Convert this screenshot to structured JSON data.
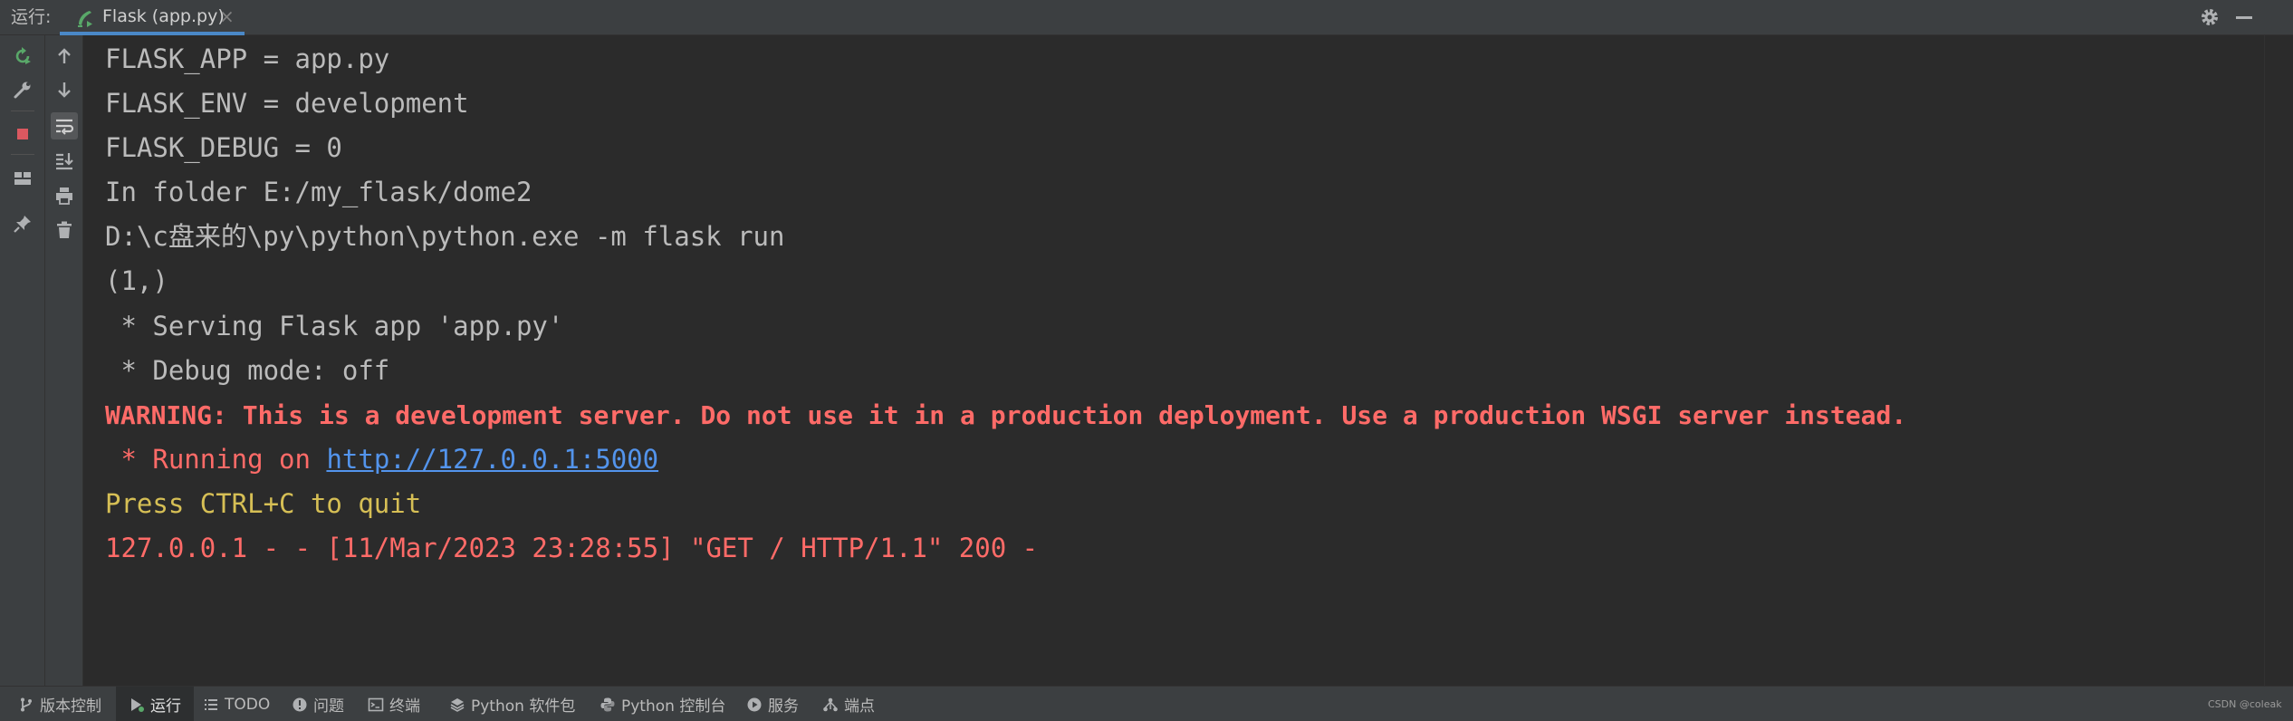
{
  "header": {
    "run_label": "运行:",
    "tab_label": "Flask (app.py)",
    "tab_close": "×"
  },
  "console": {
    "lines": [
      {
        "text": "FLASK_APP = app.py"
      },
      {
        "text": "FLASK_ENV = development"
      },
      {
        "text": "FLASK_DEBUG = 0"
      },
      {
        "text": "In folder E:/my_flask/dome2"
      },
      {
        "text": "D:\\c盘来的\\py\\python\\python.exe -m flask run"
      },
      {
        "text": "(1,)"
      },
      {
        "text": " * Serving Flask app 'app.py'"
      },
      {
        "text": " * Debug mode: off"
      },
      {
        "text": "WARNING: This is a development server. Do not use it in a production deployment. Use a production WSGI server instead."
      },
      {
        "prefix": " * Running on ",
        "link": "http://127.0.0.1:5000"
      },
      {
        "text": "Press CTRL+C to quit"
      },
      {
        "text": "127.0.0.1 - - [11/Mar/2023 23:28:55] \"GET / HTTP/1.1\" 200 -"
      }
    ]
  },
  "statusbar": {
    "items": [
      {
        "label": "版本控制",
        "icon": "branch-icon"
      },
      {
        "label": "运行",
        "icon": "run-icon"
      },
      {
        "label": "TODO",
        "icon": "list-icon"
      },
      {
        "label": "问题",
        "icon": "info-icon"
      },
      {
        "label": "终端",
        "icon": "terminal-icon"
      },
      {
        "label": "Python 软件包",
        "icon": "layers-icon"
      },
      {
        "label": "Python 控制台",
        "icon": "python-icon"
      },
      {
        "label": "服务",
        "icon": "play-circle-icon"
      },
      {
        "label": "端点",
        "icon": "endpoints-icon"
      }
    ],
    "watermark": "CSDN @coleak"
  },
  "colors": {
    "background": "#2b2b2b",
    "panel": "#3c3f41",
    "accent": "#4a88c7",
    "error": "#ff6b68",
    "warning_yellow": "#d6bf55",
    "link": "#5394ec",
    "rerun_green": "#59a869",
    "stop_red": "#db5860"
  }
}
